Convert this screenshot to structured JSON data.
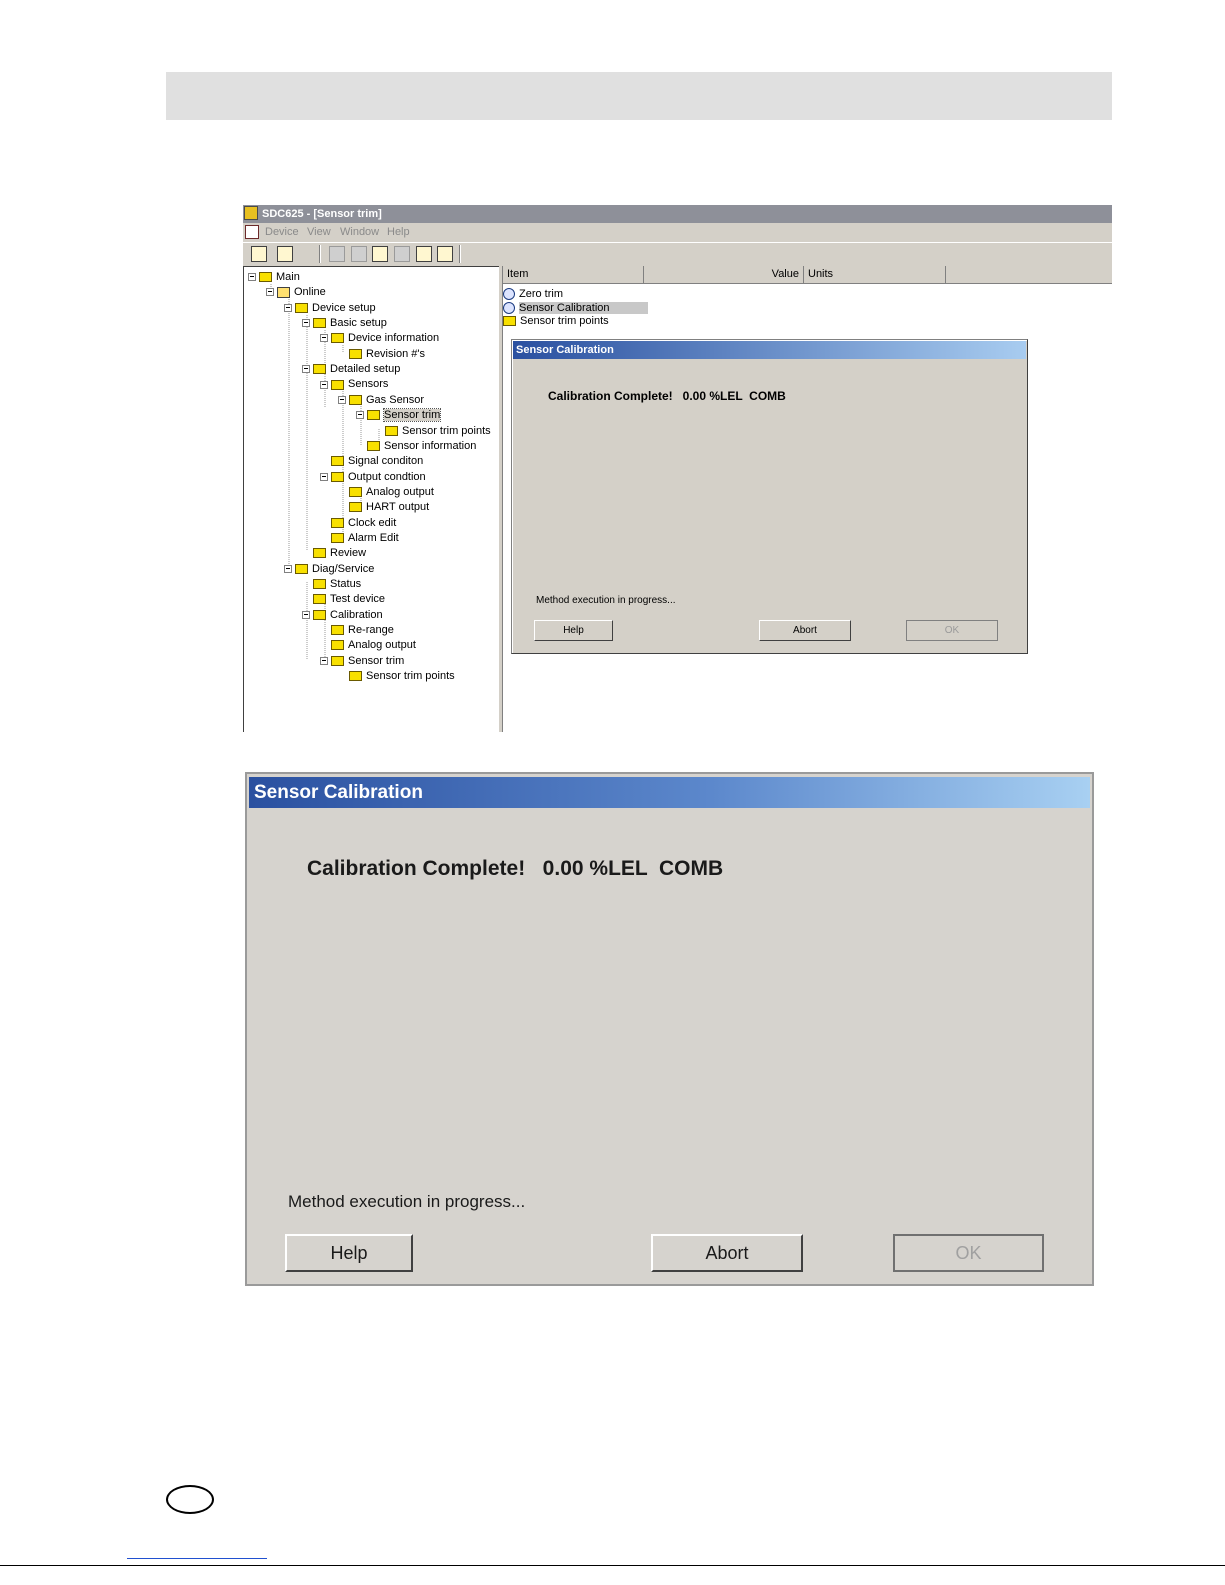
{
  "window": {
    "title": "SDC625 - [Sensor trim]",
    "menu": [
      "Device",
      "View",
      "Window",
      "Help"
    ]
  },
  "tree": [
    {
      "label": "Main",
      "icon": "folder"
    },
    {
      "label": "Online",
      "icon": "online"
    },
    {
      "label": "Device setup",
      "icon": "folder"
    },
    {
      "label": "Basic setup",
      "icon": "folder"
    },
    {
      "label": "Device information",
      "icon": "folder"
    },
    {
      "label": "Revision #'s",
      "icon": "folder"
    },
    {
      "label": "Detailed setup",
      "icon": "folder"
    },
    {
      "label": "Sensors",
      "icon": "folder"
    },
    {
      "label": "Gas Sensor",
      "icon": "folder"
    },
    {
      "label": "Sensor trim",
      "icon": "folder-open",
      "selected": true
    },
    {
      "label": "Sensor trim points",
      "icon": "folder"
    },
    {
      "label": "Sensor information",
      "icon": "folder"
    },
    {
      "label": "Signal conditon",
      "icon": "folder"
    },
    {
      "label": "Output condtion",
      "icon": "folder"
    },
    {
      "label": "Analog output",
      "icon": "folder"
    },
    {
      "label": "HART output",
      "icon": "folder"
    },
    {
      "label": "Clock edit",
      "icon": "folder"
    },
    {
      "label": "Alarm Edit",
      "icon": "folder"
    },
    {
      "label": "Review",
      "icon": "folder"
    },
    {
      "label": "Diag/Service",
      "icon": "folder"
    },
    {
      "label": "Status",
      "icon": "folder"
    },
    {
      "label": "Test device",
      "icon": "folder"
    },
    {
      "label": "Calibration",
      "icon": "folder"
    },
    {
      "label": "Re-range",
      "icon": "folder"
    },
    {
      "label": "Analog output",
      "icon": "folder"
    },
    {
      "label": "Sensor trim",
      "icon": "folder"
    },
    {
      "label": "Sensor trim points",
      "icon": "folder"
    }
  ],
  "list": {
    "columns": [
      "Item",
      "Value",
      "Units"
    ],
    "rows": [
      {
        "label": "Zero trim",
        "icon": "method"
      },
      {
        "label": "Sensor Calibration",
        "icon": "method",
        "selected": true
      },
      {
        "label": "Sensor trim points",
        "icon": "folder"
      }
    ]
  },
  "dialog": {
    "title": "Sensor Calibration",
    "message": "Calibration Complete!   0.00 %LEL  COMB",
    "status": "Method execution in progress...",
    "buttons": {
      "help": "Help",
      "abort": "Abort",
      "ok": "OK"
    }
  },
  "colors": {
    "title_gradient_start": "#2a50a0",
    "title_gradient_end": "#a8ccf0",
    "dialog_bg": "#d4d0c8",
    "folder": "#f8e000"
  }
}
